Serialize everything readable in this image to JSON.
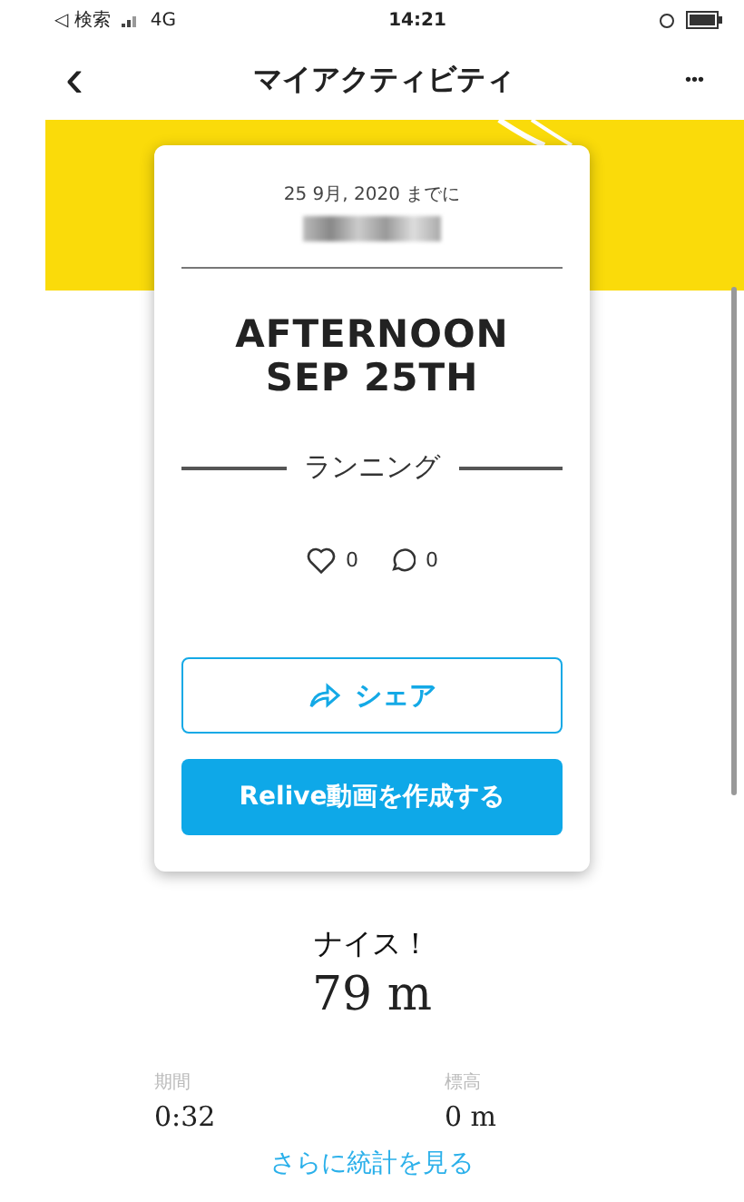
{
  "status_bar": {
    "carrier": "◁ 検索",
    "network": "4G",
    "time": "14:21"
  },
  "nav": {
    "back": "‹",
    "title": "マイアクティビティ",
    "more": "•••"
  },
  "card": {
    "date": "25 9月, 2020 までに",
    "title_lines": [
      "AFTERNOON",
      "SEP 25TH"
    ],
    "activity": "ランニング",
    "likes": "0",
    "comments": "0",
    "share_button": "シェア",
    "relive_button": "Relive動画を作成する"
  },
  "summary": {
    "headline": "ナイス！",
    "distance": "79 m",
    "stats": [
      {
        "label": "期間",
        "value": "0:32"
      },
      {
        "label": "標高",
        "value": "0 m"
      }
    ],
    "more_link": "さらに統計を見る"
  }
}
